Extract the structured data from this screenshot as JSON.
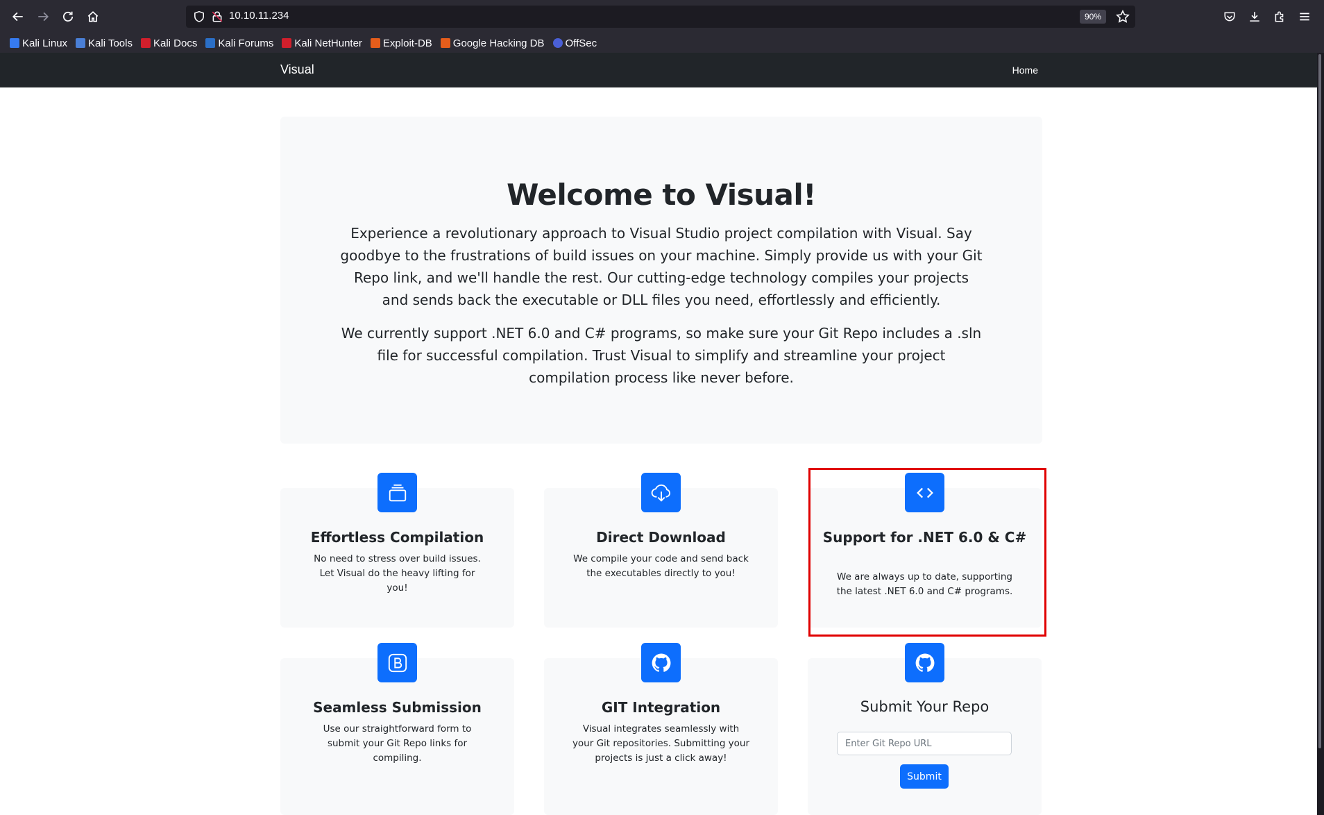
{
  "browser": {
    "url": "10.10.11.234",
    "zoom": "90%",
    "bookmarks": [
      {
        "label": "Kali Linux",
        "icon": "kali-linux-icon",
        "color": "#367bf0"
      },
      {
        "label": "Kali Tools",
        "icon": "kali-tools-icon",
        "color": "#4a7fd6"
      },
      {
        "label": "Kali Docs",
        "icon": "kali-docs-icon",
        "color": "#d11f2c"
      },
      {
        "label": "Kali Forums",
        "icon": "kali-forums-icon",
        "color": "#2b6fc7"
      },
      {
        "label": "Kali NetHunter",
        "icon": "kali-nethunter-icon",
        "color": "#d11f2c"
      },
      {
        "label": "Exploit-DB",
        "icon": "exploit-db-icon",
        "color": "#e55d1b"
      },
      {
        "label": "Google Hacking DB",
        "icon": "google-hacking-db-icon",
        "color": "#e55d1b"
      },
      {
        "label": "OffSec",
        "icon": "offsec-icon",
        "color": "#4a5fd6"
      }
    ]
  },
  "nav": {
    "brand": "Visual",
    "home": "Home"
  },
  "hero": {
    "title": "Welcome to Visual!",
    "p1": "Experience a revolutionary approach to Visual Studio project compilation with Visual. Say goodbye to the frustrations of build issues on your machine. Simply provide us with your Git Repo link, and we'll handle the rest. Our cutting-edge technology compiles your projects and sends back the executable or DLL files you need, effortlessly and efficiently.",
    "p2": "We currently support .NET 6.0 and C# programs, so make sure your Git Repo includes a .sln file for successful compilation. Trust Visual to simplify and streamline your project compilation process like never before."
  },
  "features": [
    {
      "title": "Effortless Compilation",
      "text": "No need to stress over build issues. Let Visual do the heavy lifting for you!",
      "icon": "collection-icon"
    },
    {
      "title": "Direct Download",
      "text": "We compile your code and send back the executables directly to you!",
      "icon": "cloud-download-icon"
    },
    {
      "title": "Support for .NET 6.0 & C#",
      "text": "We are always up to date, supporting the latest .NET 6.0 and C# programs.",
      "icon": "code-icon"
    },
    {
      "title": "Seamless Submission",
      "text": "Use our straightforward form to submit your Git Repo links for compiling.",
      "icon": "bootstrap-icon"
    },
    {
      "title": "GIT Integration",
      "text": "Visual integrates seamlessly with your Git repositories. Submitting your projects is just a click away!",
      "icon": "github-icon"
    }
  ],
  "form": {
    "title": "Submit Your Repo",
    "placeholder": "Enter Git Repo URL",
    "value": "",
    "submit": "Submit",
    "icon": "github-icon"
  },
  "colors": {
    "accent": "#0d6efd",
    "navbar": "#212529",
    "highlight": "#e00000"
  }
}
